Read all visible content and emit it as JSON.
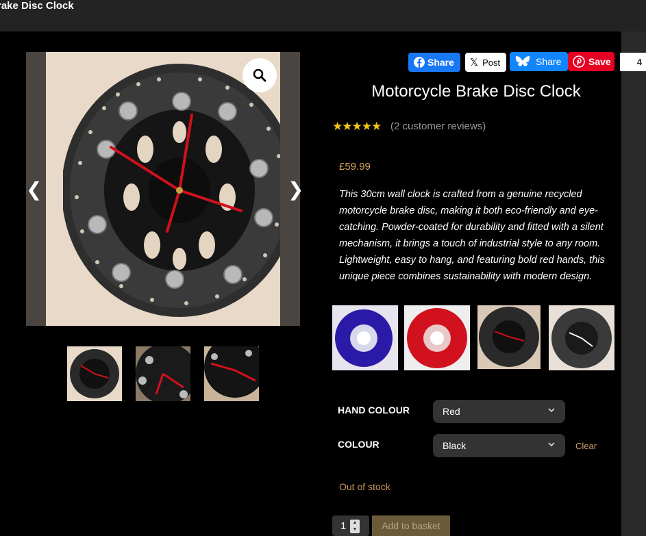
{
  "header": {
    "title": "rake Disc Clock"
  },
  "gallery": {
    "prev_arrow": "❮",
    "next_arrow": "❯",
    "zoom_icon": "magnifier-icon"
  },
  "share": {
    "facebook": "Share",
    "x": "Post",
    "bluesky": "Share",
    "pinterest": "Save",
    "count": "4",
    "colors": {
      "facebook": "#1877f2",
      "bluesky": "#1185fe",
      "pinterest": "#e60023"
    }
  },
  "product": {
    "title": "Motorcycle Brake Disc Clock",
    "rating_stars": "★★★★★",
    "reviews": "(2 customer reviews)",
    "price": "£59.99",
    "description": "This 30cm wall clock is crafted from a genuine recycled motorcycle brake disc, making it both eco-friendly and eye-catching. Powder-coated for durability and fitted with a silent mechanism, it brings a touch of industrial style to any room. Lightweight, easy to hang, and featuring bold red hands, this unique piece combines sustainability with modern design."
  },
  "variants": [
    {
      "color": "#2b1aa8"
    },
    {
      "color": "#d1121e"
    },
    {
      "color": "#2a2a2a"
    },
    {
      "color": "#3a3a3a"
    }
  ],
  "options": {
    "hand_colour_label": "HAND COLOUR",
    "hand_colour_value": "Red",
    "colour_label": "COLOUR",
    "colour_value": "Black",
    "clear": "Clear"
  },
  "stock": "Out of stock",
  "cart": {
    "qty": "1",
    "add_label": "Add to basket"
  },
  "colors": {
    "accent": "#d6a357",
    "background": "#000000"
  }
}
